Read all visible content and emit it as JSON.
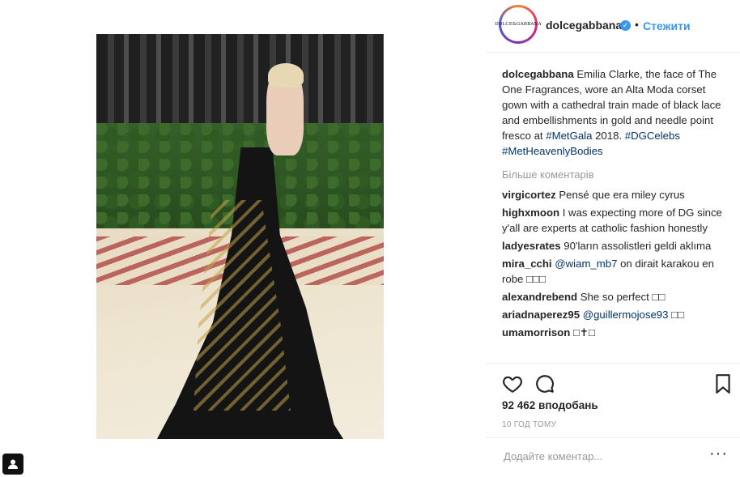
{
  "header": {
    "avatar_text": "DOLCE&GABBANA",
    "username": "dolcegabbana",
    "verified_icon": "✓",
    "separator": "•",
    "follow_label": "Стежити"
  },
  "caption": {
    "user": "dolcegabbana",
    "text_1": " Emilia Clarke, the face of The One Fragrances, wore an Alta Moda corset gown with a cathedral train made of black lace and embellishments in gold and needle point fresco at ",
    "tag_1": "#MetGala",
    "text_2": " 2018. ",
    "tag_2": "#DGCelebs",
    "tag_3": "#MetHeavenlyBodies"
  },
  "more_comments_label": "Більше коментарів",
  "comments": [
    {
      "user": "virgicortez",
      "pre": " Pensé que era miley cyrus",
      "mention": "",
      "post": ""
    },
    {
      "user": "highxmoon",
      "pre": " I was expecting more of DG since y'all are experts at catholic fashion honestly",
      "mention": "",
      "post": ""
    },
    {
      "user": "ladyesrates",
      "pre": " 90'ların assolistleri geldi aklıma",
      "mention": "",
      "post": ""
    },
    {
      "user": "mira_cchi",
      "pre": " ",
      "mention": "@wiam_mb7",
      "post": " on dirait karakou en robe □□□"
    },
    {
      "user": "alexandrebend",
      "pre": " She so perfect □□",
      "mention": "",
      "post": ""
    },
    {
      "user": "ariadnaperez95",
      "pre": " ",
      "mention": "@guillermojose93",
      "post": " □□"
    },
    {
      "user": "umamorrison",
      "pre": " □✝□",
      "mention": "",
      "post": ""
    }
  ],
  "actions": {
    "like_icon": "heart-outline-icon",
    "comment_icon": "speech-bubble-icon",
    "save_icon": "bookmark-icon"
  },
  "likes_label": "92 462 вподобань",
  "time_ago": "10 ГОД ТОМУ",
  "add_comment": {
    "placeholder": "Додайте коментар...",
    "more_label": "···"
  },
  "colors": {
    "link": "#003569",
    "accent": "#3897f0",
    "muted": "#999999"
  }
}
